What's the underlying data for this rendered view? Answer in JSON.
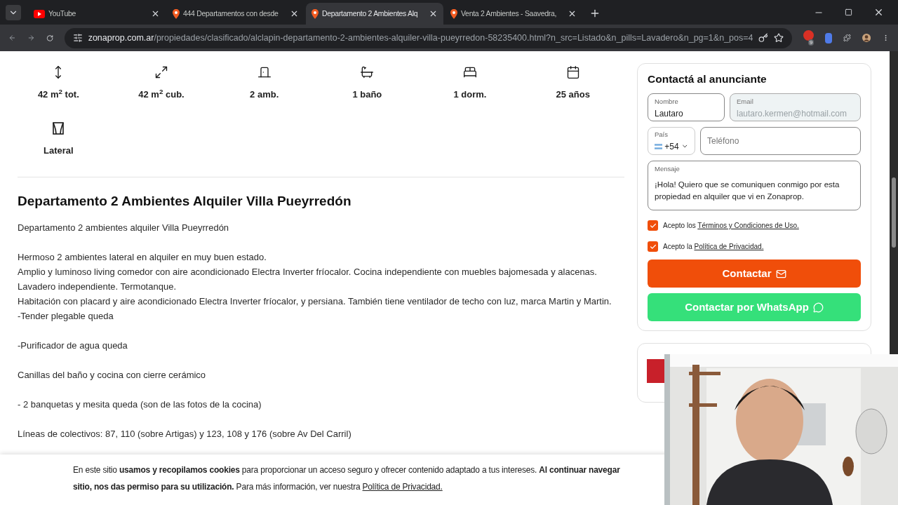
{
  "browser": {
    "tabs": [
      {
        "title": "YouTube",
        "kind": "youtube",
        "selected": false
      },
      {
        "title": "444 Departamentos con desde",
        "kind": "zonaprop",
        "selected": false
      },
      {
        "title": "Departamento 2 Ambientes Alq",
        "kind": "zonaprop",
        "selected": true
      },
      {
        "title": "Venta 2 Ambientes - Saavedra,",
        "kind": "zonaprop",
        "selected": false
      }
    ],
    "url_domain": "zonaprop.com.ar",
    "url_path": "/propiedades/clasificado/alclapin-departamento-2-ambientes-alquiler-villa-pueyrredon-58235400.html?n_src=Listado&n_pills=Lavadero&n_pg=1&n_pos=4",
    "extension_badge": "9"
  },
  "features": [
    {
      "kind": "area",
      "label": "42 m$^{2}$ tot."
    },
    {
      "kind": "covered",
      "label": "42 m$^{2}$ cub."
    },
    {
      "kind": "rooms",
      "label": "2 amb."
    },
    {
      "kind": "bath",
      "label": "1 baño"
    },
    {
      "kind": "bed",
      "label": "1 dorm."
    },
    {
      "kind": "age",
      "label": "25 años"
    },
    {
      "kind": "view",
      "label": "Lateral"
    }
  ],
  "description": {
    "title": "Departamento 2 Ambientes Alquiler Villa Pueyrredón",
    "paragraphs": [
      [
        "Departamento 2 ambientes alquiler Villa Pueyrredón"
      ],
      [
        "Hermoso 2 ambientes lateral en alquiler en muy buen estado.",
        "Amplio y luminoso living comedor con aire acondicionado Electra Inverter fríocalor. Cocina independiente con muebles bajomesada y alacenas.",
        "Lavadero independiente. Termotanque.",
        "Habitación con placard y aire acondicionado Electra Inverter fríocalor, y persiana. También tiene ventilador de techo con luz, marca Martin y Martin.",
        "-Tender plegable queda"
      ],
      [
        "-Purificador de agua queda"
      ],
      [
        "Canillas del baño y cocina con cierre cerámico"
      ],
      [
        "- 2 banquetas y mesita queda (son de las fotos de la cocina)"
      ],
      [
        "Líneas de colectivos: 87, 110 (sobre Artigas) y 123, 108 y 176 (sobre Av Del Carril)"
      ]
    ]
  },
  "contact": {
    "title": "Contactá al anunciante",
    "name": {
      "label": "Nombre",
      "value": "Lautaro"
    },
    "email": {
      "label": "Email",
      "value": "lautaro.kermen@hotmail.com",
      "disabled": true
    },
    "country": {
      "label": "País",
      "value": "+54"
    },
    "phone": {
      "placeholder": "Teléfono"
    },
    "message": {
      "label": "Mensaje",
      "value": "¡Hola! Quiero que se comuniquen conmigo por esta propiedad en alquiler que vi en Zonaprop."
    },
    "consents": [
      {
        "text": "Acepto los ",
        "link": "Términos y Condiciones de Uso.",
        "checked": true
      },
      {
        "text": "Acepto la ",
        "link": "Política de Privacidad.",
        "checked": true
      }
    ],
    "buttons": [
      {
        "kind": "email",
        "label": "Contactar"
      },
      {
        "kind": "whatsapp",
        "label": "Contactar por WhatsApp"
      }
    ]
  },
  "cookie_banner": {
    "line1": "En este sitio **usamos y recopilamos cookies** para proporcionar un acceso seguro y ofrecer contenido adaptado a tus intereses. **Al continuar navegar**",
    "line2": "**sitio, nos das permiso para su utilización.** Para más información, ver nuestra ",
    "link": "Política de Privacidad."
  }
}
